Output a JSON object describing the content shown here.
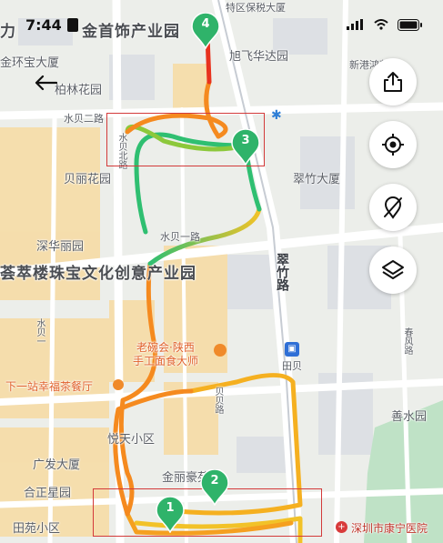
{
  "status": {
    "time": "7:44"
  },
  "labels": {
    "top1": "力",
    "top2": "金首饰产业园",
    "tax": "特区保税大厦",
    "jinhua": "金环宝大厦",
    "bolin": "柏林花园",
    "xuda": "旭飞华达园",
    "xingang": "新港鸿花园",
    "shuibei2": "水贝二路",
    "beili": "贝丽花园",
    "cuizhu": "翠竹大厦",
    "shuibei1": "水贝一路",
    "shenhua": "深华丽园",
    "cuilou": "荟萃楼珠宝文化创意产业园",
    "cuizhulu": "翠竹路",
    "laopi1": "老碗会·陕西",
    "laopi2": "手工面食大师",
    "tianbei": "田贝",
    "tea": "下一站幸福茶餐厅",
    "yuetian": "悦天小区",
    "shanhu": "善水园",
    "jinlihao": "金丽豪苑",
    "guangfa": "广发大厦",
    "hexing": "合正星园",
    "tianyuan": "田苑小区",
    "hospital": "深圳市康宁医院",
    "shuibei_v": "水贝北路",
    "shuibei_v2": "水贝一",
    "dongbei_v": "贝丽北",
    "rightv": "春风路",
    "midv": "贝贝路"
  },
  "pins": [
    "1",
    "2",
    "3",
    "4"
  ],
  "buttons": {
    "back": "back",
    "share": "share",
    "locate": "locate",
    "hide": "hide-track",
    "layers": "layers"
  },
  "colors": {
    "route_start": "#f2c228",
    "route_mid": "#f58a1f",
    "route_red": "#e8321e",
    "route_green": "#2fbf71",
    "pin": "#2fb36a",
    "highlight": "#d33a3a"
  }
}
